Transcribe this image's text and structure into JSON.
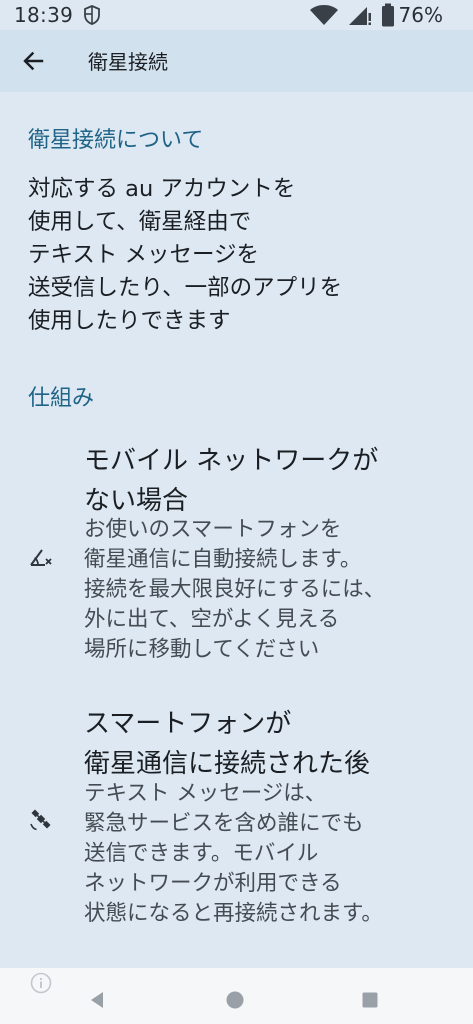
{
  "status_bar": {
    "time": "18:39",
    "battery": "76%",
    "icons": [
      "shield-icon",
      "wifi-icon",
      "signal-icon",
      "battery-icon"
    ]
  },
  "app_bar": {
    "title": "衛星接続",
    "back_icon": "arrow-back-icon"
  },
  "about": {
    "heading": "衛星接続について",
    "body": "対応する au アカウントを\n使用して、衛星経由で\nテキスト メッセージを\n送受信したり、一部のアプリを\n使用したりできます"
  },
  "how_it_works": {
    "heading": "仕組み",
    "items": [
      {
        "icon": "satellite-signal-off-icon",
        "title": "モバイル ネットワークが\nない場合",
        "description": "お使いのスマートフォンを\n衛星通信に自動接続します。\n接続を最大限良好にするには、\n外に出て、空がよく見える\n場所に移動してください"
      },
      {
        "icon": "satellite-icon",
        "title": "スマートフォンが\n衛星通信に接続された後",
        "description": "テキスト メッセージは、\n緊急サービスを含め誰にでも\n送信できます。モバイル\nネットワークが利用できる\n状態になると再接続されます。"
      }
    ]
  },
  "footer": {
    "icon": "info-icon"
  },
  "nav_bar": {
    "buttons": [
      "back-triangle-icon",
      "home-circle-icon",
      "recents-square-icon"
    ]
  },
  "colors": {
    "background": "#dde8f2",
    "app_bar": "#d2e1ee",
    "accent": "#1f6386",
    "text": "#1b1f24",
    "secondary_text": "#454b52"
  }
}
